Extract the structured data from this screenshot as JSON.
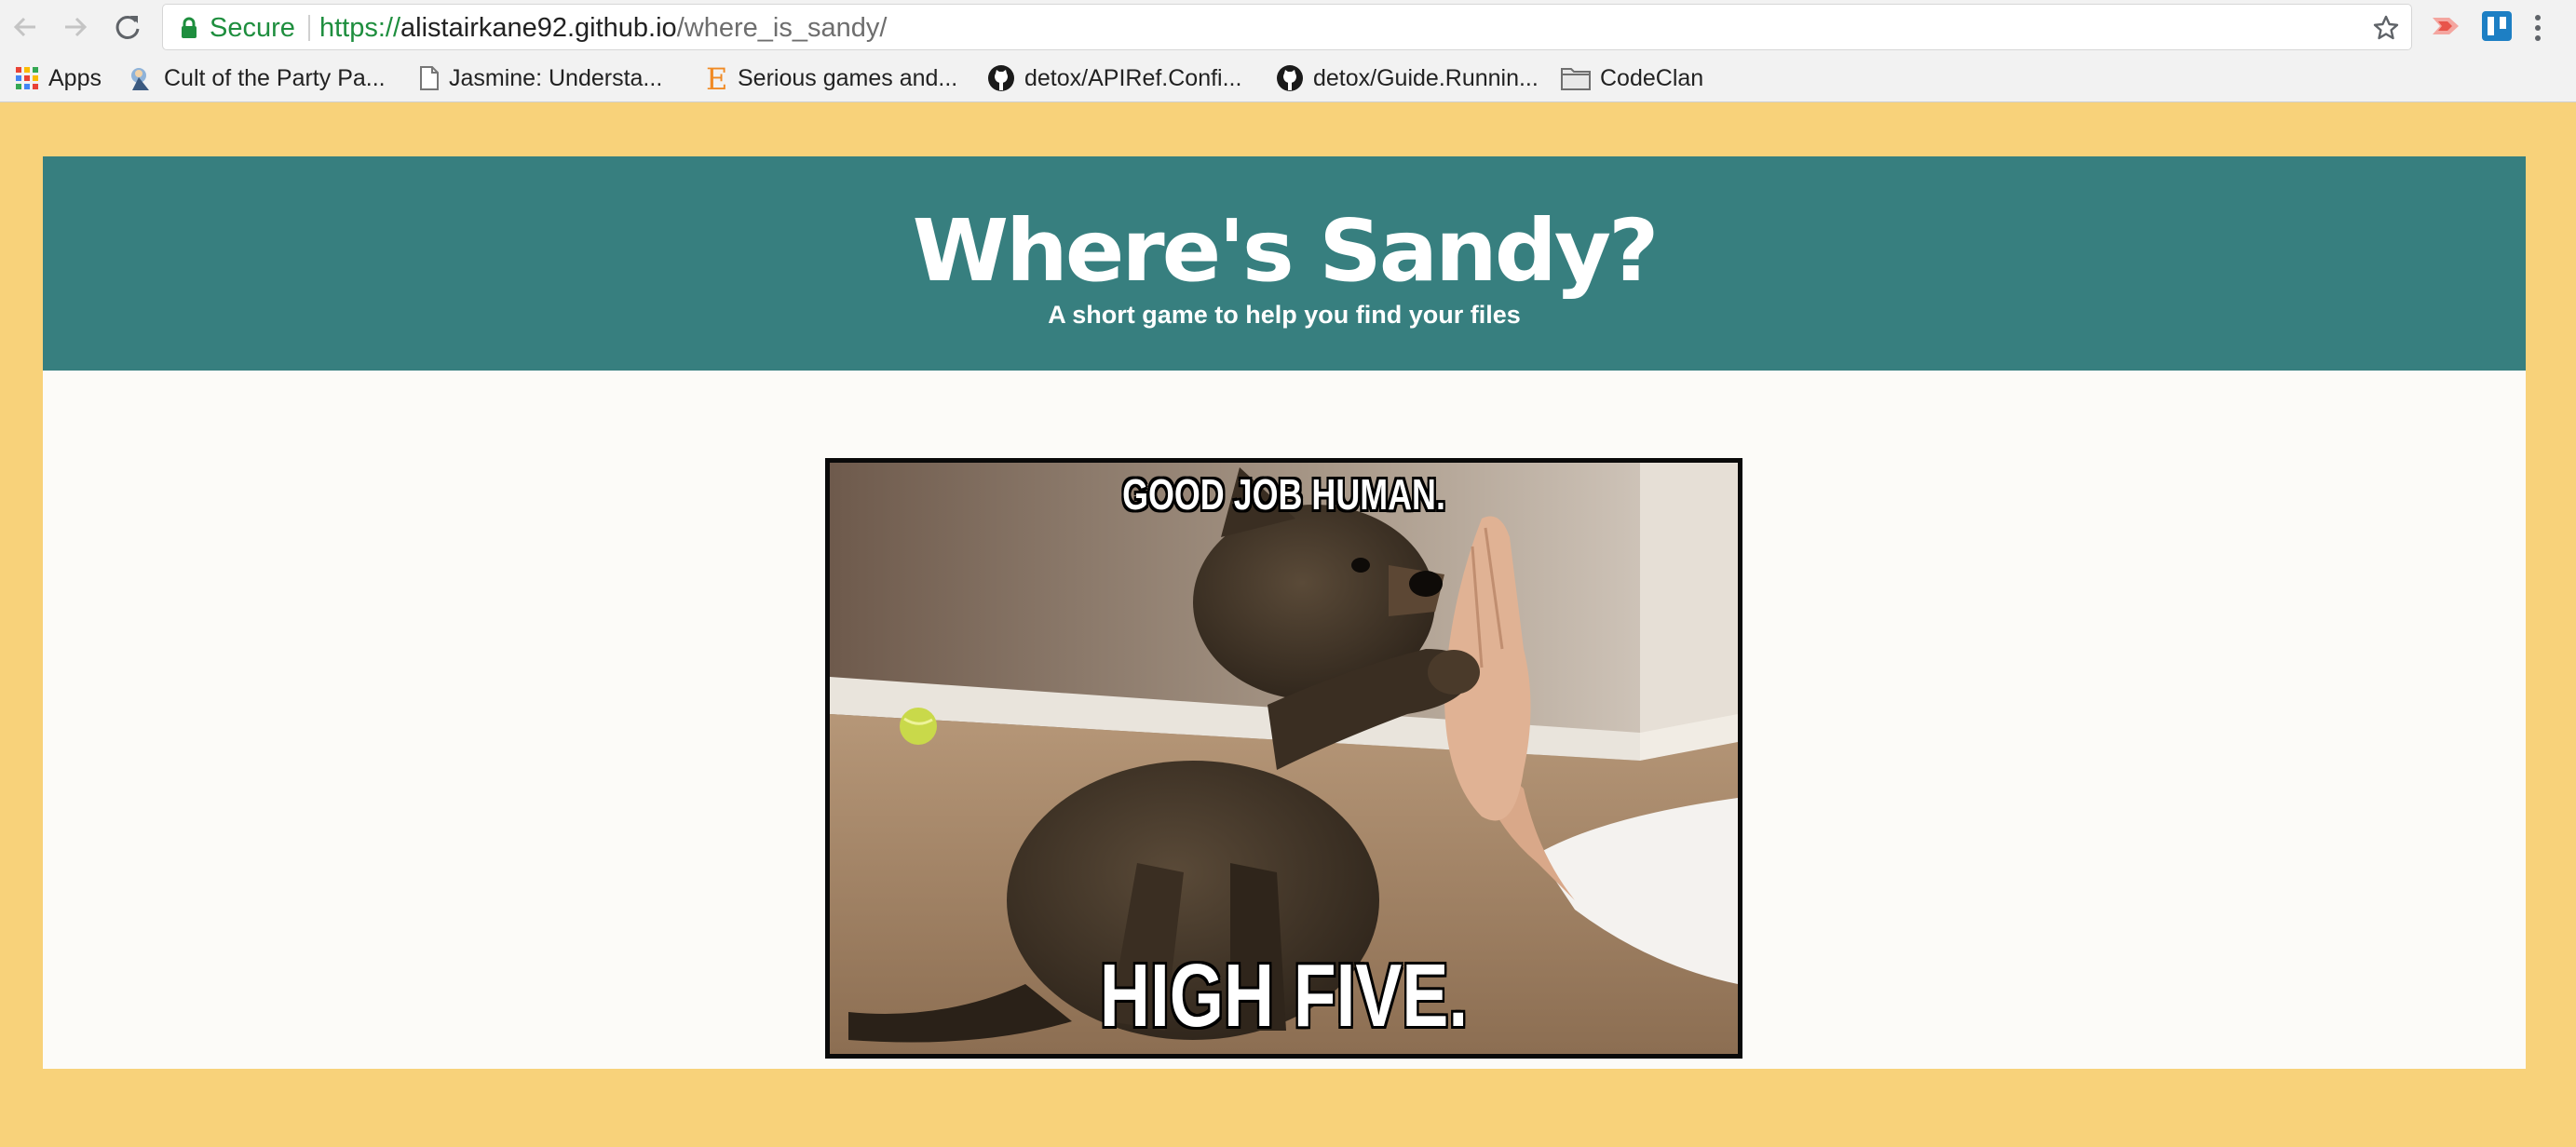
{
  "browser": {
    "secure_label": "Secure",
    "url": {
      "scheme": "https://",
      "host": "alistairkane92.github.io",
      "path": "/where_is_sandy/"
    },
    "icons": [
      "back-arrow-icon",
      "forward-arrow-icon",
      "reload-icon",
      "lock-icon",
      "star-icon",
      "extension-icon",
      "extension-icon",
      "menu-icon"
    ]
  },
  "bookmarks": [
    {
      "label": "Apps",
      "icon": "apps-grid-icon"
    },
    {
      "label": "Cult of the Party Pa...",
      "icon": "favicon-icon"
    },
    {
      "label": "Jasmine: Understa...",
      "icon": "page-icon"
    },
    {
      "label": "Serious games and...",
      "icon": "letter-e-icon"
    },
    {
      "label": "detox/APIRef.Confi...",
      "icon": "github-icon"
    },
    {
      "label": "detox/Guide.Runnin...",
      "icon": "github-icon"
    },
    {
      "label": "CodeClan",
      "icon": "folder-icon"
    }
  ],
  "page": {
    "title": "Where's Sandy?",
    "subtitle": "A short game to help you find your files",
    "meme": {
      "caption_top": "GOOD JOB HUMAN.",
      "caption_bottom": "HIGH FIVE."
    }
  },
  "colors": {
    "page_background": "#f8d27a",
    "header_band": "#377f7f",
    "content_panel": "#fcfbf8",
    "secure_green": "#1e8e3e"
  }
}
